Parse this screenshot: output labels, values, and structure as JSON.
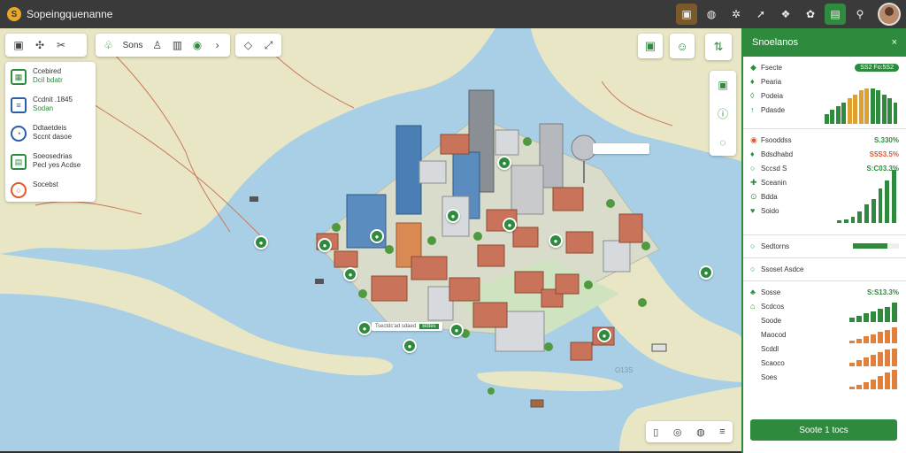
{
  "app": {
    "title": "Sopeingquenanne",
    "logo_letter": "S"
  },
  "topbar": {
    "icons": [
      "layers-icon",
      "globe-icon",
      "nodes-icon",
      "pin-icon",
      "user-group-icon",
      "map-icon",
      "book-icon",
      "chat-icon"
    ],
    "active_icon": "book-icon"
  },
  "toolbar": {
    "group1": [
      "save-icon",
      "tree-icon",
      "route-icon"
    ],
    "group2_label": "Sons",
    "group2": [
      "leaf-icon",
      "person-icon",
      "book-icon",
      "badge-icon"
    ],
    "group3": [
      "shapes-icon",
      "expand-icon"
    ]
  },
  "layers": [
    {
      "title": "Ccebired",
      "sub": "Dcil bdatr",
      "icon": "building-icon"
    },
    {
      "title": "Ccdnit .1845",
      "sub": "Sodan",
      "icon": "list-icon"
    },
    {
      "title": "Ddtaetdeis",
      "sub": "Sccnt dasoe",
      "icon": "circle-icon"
    },
    {
      "title": "Soeosedrias",
      "sub": "Pecl yes Acdse",
      "icon": "chart-icon"
    },
    {
      "title": "Socebst",
      "sub": "",
      "icon": "ring-icon"
    }
  ],
  "map": {
    "callout_text": "Tsectdc'ad sdaed",
    "callout_tag": "Bdtes",
    "watermark": "O13S",
    "top_label": ""
  },
  "sidebar": {
    "title": "Snoelanos",
    "close": "×",
    "section1": {
      "header": "Fsecte",
      "pill": "SS2 Fo:5S2",
      "rows": [
        "Pearia",
        "Podeia",
        "Pdasde"
      ],
      "bar_values": [
        10,
        14,
        18,
        22,
        26,
        30,
        34,
        36,
        36,
        34,
        30,
        26,
        22
      ]
    },
    "section2": {
      "rows": [
        {
          "label": "Fsooddss",
          "value": "S.330%",
          "color": "green",
          "icon": "fire-icon"
        },
        {
          "label": "Bdsdhabd",
          "value": "S5S3.5%",
          "color": "orange"
        },
        {
          "label": "Sccsd S",
          "value": "S:C03.3%",
          "color": "green"
        },
        {
          "label": "Sceanin",
          "value": "",
          "color": "green"
        },
        {
          "label": "Bdda",
          "value": "",
          "color": "green"
        },
        {
          "label": "Soido",
          "value": "",
          "color": "green"
        }
      ],
      "bar_values": [
        2,
        3,
        5,
        9,
        14,
        18,
        26,
        32,
        40
      ]
    },
    "section3": {
      "label": "Sedtorns",
      "progress": 0.75
    },
    "section4": {
      "label": "Ssoset Asdce"
    },
    "section5": {
      "header": "Sosse",
      "header_value": "S:S13.3%",
      "rows": [
        "Scdcos",
        "Soode",
        "Maocod",
        "Scddl",
        "Scaoco",
        "Soes"
      ],
      "green_bars": [
        4,
        6,
        8,
        10,
        12,
        14,
        18
      ],
      "orange_bars_a": [
        2,
        4,
        6,
        8,
        10,
        12,
        14
      ],
      "orange_bars_b": [
        3,
        5,
        7,
        9,
        11,
        13,
        14
      ],
      "orange_bars_c": [
        2,
        4,
        6,
        8,
        11,
        14,
        16
      ]
    },
    "action_button": "Soote 1 tocs"
  },
  "bottom_tools": [
    "print-icon",
    "camera-icon",
    "globe-icon",
    "menu-icon"
  ],
  "colors": {
    "accent": "#2e8b3d",
    "orange": "#e0582a",
    "water": "#a9cfe6",
    "land": "#e6e7c8"
  }
}
